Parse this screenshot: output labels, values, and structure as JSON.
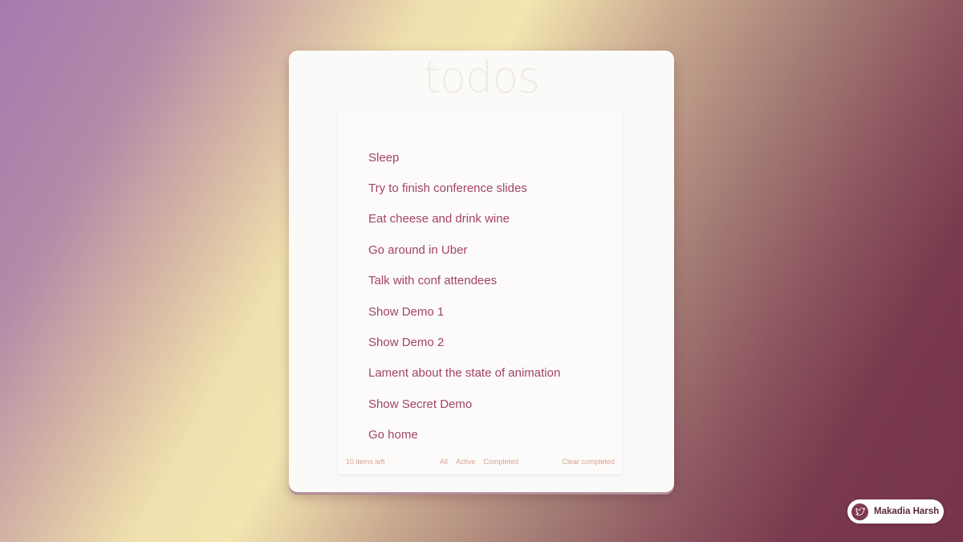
{
  "app": {
    "title": "todos"
  },
  "todos": [
    {
      "label": "Sleep"
    },
    {
      "label": "Try to finish conference slides"
    },
    {
      "label": "Eat cheese and drink wine"
    },
    {
      "label": "Go around in Uber"
    },
    {
      "label": "Talk with conf attendees"
    },
    {
      "label": "Show Demo 1"
    },
    {
      "label": "Show Demo 2"
    },
    {
      "label": "Lament about the state of animation"
    },
    {
      "label": "Show Secret Demo"
    },
    {
      "label": "Go home"
    }
  ],
  "footer": {
    "count_text": "10 items left",
    "filters": {
      "all": "All",
      "active": "Active",
      "completed": "Completed"
    },
    "clear_completed": "Clear completed"
  },
  "badge": {
    "name": "Makadia Harsh",
    "icon": "twitter-bird-icon"
  },
  "colors": {
    "todo_text": "#a24466",
    "footer_text": "#d9a191",
    "title_text": "#c8786e",
    "badge_avatar": "#7e3a52"
  }
}
